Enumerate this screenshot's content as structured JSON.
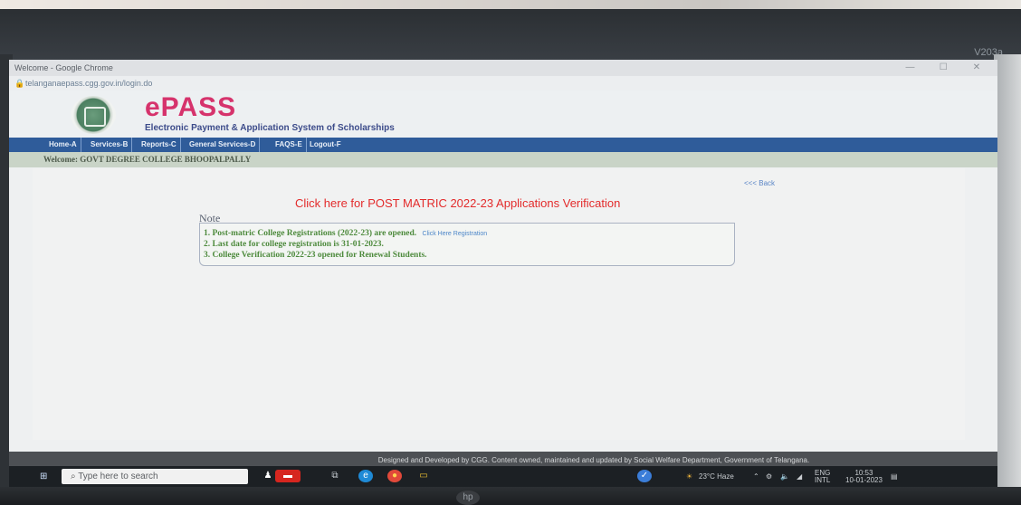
{
  "monitor": {
    "model_label": "V203a"
  },
  "browser": {
    "window_title": "Welcome - Google Chrome",
    "url": "telanganaepass.cgg.gov.in/login.do",
    "window_controls": [
      "—",
      "☐",
      "✕"
    ]
  },
  "site": {
    "logo_title": "ePASS",
    "logo_subtitle": "Electronic Payment & Application System of Scholarships",
    "menu": [
      {
        "label": "Home-A"
      },
      {
        "label": "Services-B"
      },
      {
        "label": "Reports-C"
      },
      {
        "label": "General Services-D"
      },
      {
        "label": "FAQS-E"
      },
      {
        "label": "Logout-F"
      }
    ],
    "welcome_text": "Welcome: GOVT DEGREE COLLEGE BHOOPALPALLY",
    "back_link": "<<< Back",
    "verification_link": "Click here for POST MATRIC 2022-23 Applications Verification",
    "note": {
      "title": "Note",
      "lines": [
        {
          "text": "1. Post-matric College Registrations (2022-23) are opened.",
          "link": "Click Here Registration"
        },
        {
          "text": "2. Last date for college registration is 31-01-2023."
        },
        {
          "text": "3. College Verification 2022-23 opened for Renewal Students."
        }
      ]
    },
    "footer": "Designed and Developed by CGG. Content owned, maintained and updated by Social Welfare Department, Government of Telangana."
  },
  "taskbar": {
    "search_placeholder": "Type here to search",
    "weather": "23°C Haze",
    "language_top": "ENG",
    "language_bottom": "INTL",
    "time": "10:53",
    "date": "10-01-2023"
  },
  "colors": {
    "menu_bar": "#2f5c9a",
    "logo_pink": "#d6336c",
    "verify_red": "#e32b2b",
    "note_green": "#4d8a3c"
  }
}
